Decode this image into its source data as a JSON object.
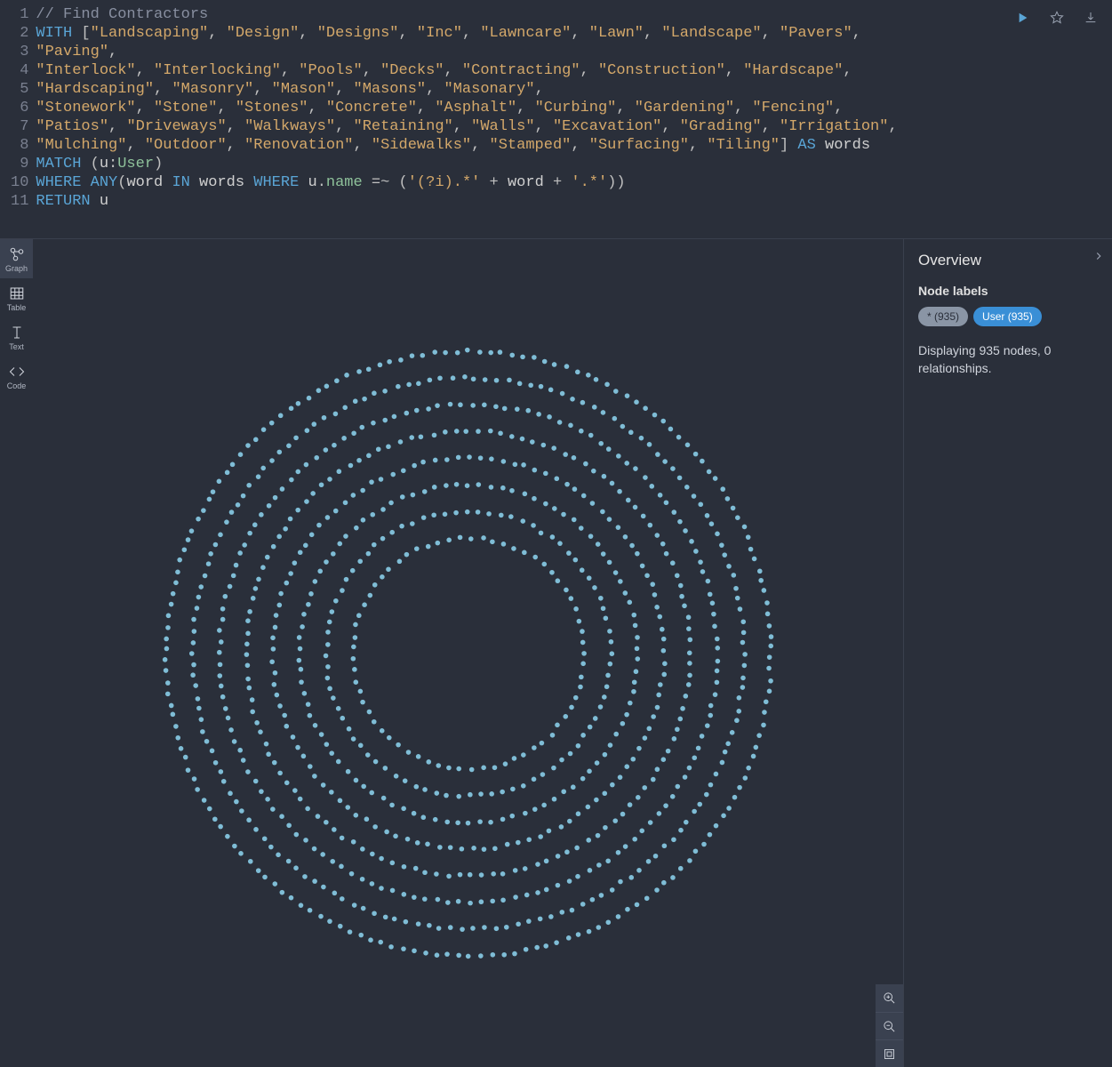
{
  "editor": {
    "line_count": 11,
    "code_tokens": [
      [
        {
          "t": "comment",
          "v": "// Find Contractors"
        }
      ],
      [
        {
          "t": "keyword",
          "v": "WITH"
        },
        {
          "t": "punct",
          "v": " ["
        },
        {
          "t": "string",
          "v": "\"Landscaping\""
        },
        {
          "t": "punct",
          "v": ", "
        },
        {
          "t": "string",
          "v": "\"Design\""
        },
        {
          "t": "punct",
          "v": ", "
        },
        {
          "t": "string",
          "v": "\"Designs\""
        },
        {
          "t": "punct",
          "v": ", "
        },
        {
          "t": "string",
          "v": "\"Inc\""
        },
        {
          "t": "punct",
          "v": ", "
        },
        {
          "t": "string",
          "v": "\"Lawncare\""
        },
        {
          "t": "punct",
          "v": ", "
        },
        {
          "t": "string",
          "v": "\"Lawn\""
        },
        {
          "t": "punct",
          "v": ", "
        },
        {
          "t": "string",
          "v": "\"Landscape\""
        },
        {
          "t": "punct",
          "v": ", "
        },
        {
          "t": "string",
          "v": "\"Pavers\""
        },
        {
          "t": "punct",
          "v": ", "
        },
        {
          "t": "string",
          "v": "\"Paving\""
        },
        {
          "t": "punct",
          "v": ", "
        }
      ],
      [
        {
          "t": "string",
          "v": "\"Interlock\""
        },
        {
          "t": "punct",
          "v": ", "
        },
        {
          "t": "string",
          "v": "\"Interlocking\""
        },
        {
          "t": "punct",
          "v": ", "
        },
        {
          "t": "string",
          "v": "\"Pools\""
        },
        {
          "t": "punct",
          "v": ", "
        },
        {
          "t": "string",
          "v": "\"Decks\""
        },
        {
          "t": "punct",
          "v": ", "
        },
        {
          "t": "string",
          "v": "\"Contracting\""
        },
        {
          "t": "punct",
          "v": ", "
        },
        {
          "t": "string",
          "v": "\"Construction\""
        },
        {
          "t": "punct",
          "v": ", "
        },
        {
          "t": "string",
          "v": "\"Hardscape\""
        },
        {
          "t": "punct",
          "v": ", "
        }
      ],
      [
        {
          "t": "string",
          "v": "\"Hardscaping\""
        },
        {
          "t": "punct",
          "v": ", "
        },
        {
          "t": "string",
          "v": "\"Masonry\""
        },
        {
          "t": "punct",
          "v": ", "
        },
        {
          "t": "string",
          "v": "\"Mason\""
        },
        {
          "t": "punct",
          "v": ", "
        },
        {
          "t": "string",
          "v": "\"Masons\""
        },
        {
          "t": "punct",
          "v": ", "
        },
        {
          "t": "string",
          "v": "\"Masonary\""
        },
        {
          "t": "punct",
          "v": ", "
        }
      ],
      [
        {
          "t": "string",
          "v": "\"Stonework\""
        },
        {
          "t": "punct",
          "v": ", "
        },
        {
          "t": "string",
          "v": "\"Stone\""
        },
        {
          "t": "punct",
          "v": ", "
        },
        {
          "t": "string",
          "v": "\"Stones\""
        },
        {
          "t": "punct",
          "v": ", "
        },
        {
          "t": "string",
          "v": "\"Concrete\""
        },
        {
          "t": "punct",
          "v": ", "
        },
        {
          "t": "string",
          "v": "\"Asphalt\""
        },
        {
          "t": "punct",
          "v": ", "
        },
        {
          "t": "string",
          "v": "\"Curbing\""
        },
        {
          "t": "punct",
          "v": ", "
        },
        {
          "t": "string",
          "v": "\"Gardening\""
        },
        {
          "t": "punct",
          "v": ", "
        },
        {
          "t": "string",
          "v": "\"Fencing\""
        },
        {
          "t": "punct",
          "v": ", "
        }
      ],
      [
        {
          "t": "string",
          "v": "\"Patios\""
        },
        {
          "t": "punct",
          "v": ", "
        },
        {
          "t": "string",
          "v": "\"Driveways\""
        },
        {
          "t": "punct",
          "v": ", "
        },
        {
          "t": "string",
          "v": "\"Walkways\""
        },
        {
          "t": "punct",
          "v": ", "
        },
        {
          "t": "string",
          "v": "\"Retaining\""
        },
        {
          "t": "punct",
          "v": ", "
        },
        {
          "t": "string",
          "v": "\"Walls\""
        },
        {
          "t": "punct",
          "v": ", "
        },
        {
          "t": "string",
          "v": "\"Excavation\""
        },
        {
          "t": "punct",
          "v": ", "
        },
        {
          "t": "string",
          "v": "\"Grading\""
        },
        {
          "t": "punct",
          "v": ", "
        },
        {
          "t": "string",
          "v": "\"Irrigation\""
        },
        {
          "t": "punct",
          "v": ", "
        }
      ],
      [
        {
          "t": "string",
          "v": "\"Mulching\""
        },
        {
          "t": "punct",
          "v": ", "
        },
        {
          "t": "string",
          "v": "\"Outdoor\""
        },
        {
          "t": "punct",
          "v": ", "
        },
        {
          "t": "string",
          "v": "\"Renovation\""
        },
        {
          "t": "punct",
          "v": ", "
        },
        {
          "t": "string",
          "v": "\"Sidewalks\""
        },
        {
          "t": "punct",
          "v": ", "
        },
        {
          "t": "string",
          "v": "\"Stamped\""
        },
        {
          "t": "punct",
          "v": ", "
        },
        {
          "t": "string",
          "v": "\"Surfacing\""
        },
        {
          "t": "punct",
          "v": ", "
        },
        {
          "t": "string",
          "v": "\"Tiling\""
        },
        {
          "t": "punct",
          "v": "] "
        },
        {
          "t": "keyword",
          "v": "AS"
        },
        {
          "t": "ident",
          "v": " words"
        }
      ],
      [
        {
          "t": "keyword",
          "v": "MATCH"
        },
        {
          "t": "punct",
          "v": " ("
        },
        {
          "t": "ident",
          "v": "u"
        },
        {
          "t": "punct",
          "v": ":"
        },
        {
          "t": "label",
          "v": "User"
        },
        {
          "t": "punct",
          "v": ")"
        }
      ],
      [
        {
          "t": "keyword",
          "v": "WHERE"
        },
        {
          "t": "ident",
          "v": " "
        },
        {
          "t": "keyword",
          "v": "ANY"
        },
        {
          "t": "punct",
          "v": "("
        },
        {
          "t": "ident",
          "v": "word "
        },
        {
          "t": "keyword",
          "v": "IN"
        },
        {
          "t": "ident",
          "v": " words "
        },
        {
          "t": "keyword",
          "v": "WHERE"
        },
        {
          "t": "ident",
          "v": " u"
        },
        {
          "t": "punct",
          "v": "."
        },
        {
          "t": "prop",
          "v": "name"
        },
        {
          "t": "op",
          "v": " =~ "
        },
        {
          "t": "punct",
          "v": "("
        },
        {
          "t": "string",
          "v": "'(?i).*'"
        },
        {
          "t": "op",
          "v": " + "
        },
        {
          "t": "ident",
          "v": "word"
        },
        {
          "t": "op",
          "v": " + "
        },
        {
          "t": "string",
          "v": "'.*'"
        },
        {
          "t": "punct",
          "v": "))"
        }
      ],
      [
        {
          "t": "keyword",
          "v": "RETURN"
        },
        {
          "t": "ident",
          "v": " u"
        }
      ],
      []
    ]
  },
  "actions": {
    "run": "Run query",
    "favorite": "Save as favorite",
    "export": "Export"
  },
  "view_tabs": {
    "graph": "Graph",
    "table": "Table",
    "text": "Text",
    "code": "Code"
  },
  "zoom": {
    "in": "Zoom in",
    "out": "Zoom out",
    "fit": "Zoom to fit"
  },
  "overview": {
    "title": "Overview",
    "section_node_labels": "Node labels",
    "chips": {
      "all": "* (935)",
      "user": "User (935)"
    },
    "stats": "Displaying 935 nodes, 0 relationships.",
    "colors": {
      "all_chip_bg": "#8a95a5",
      "user_chip_bg": "#3a8fd6",
      "node_color": "#7fbdd6"
    }
  },
  "graph": {
    "node_count": 935,
    "relationship_count": 0,
    "layout": "concentric-rings",
    "ring_count": 8,
    "node_radius_px": 2.8
  }
}
